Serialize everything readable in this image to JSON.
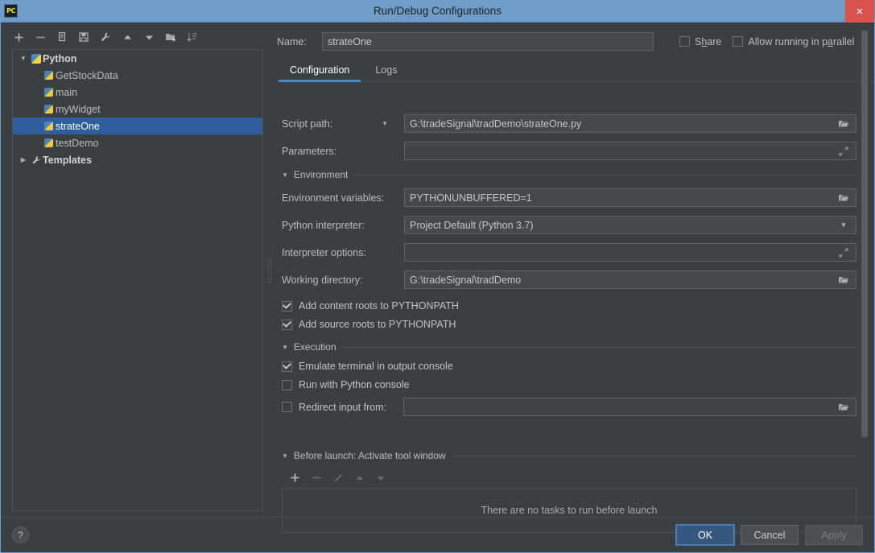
{
  "window": {
    "title": "Run/Debug Configurations",
    "app_icon": "pycharm-logo-icon",
    "close_label": "×"
  },
  "left_panel": {
    "toolbar": [
      {
        "name": "add-configuration-button",
        "icon": "plus-icon"
      },
      {
        "name": "remove-configuration-button",
        "icon": "minus-icon"
      },
      {
        "name": "copy-configuration-button",
        "icon": "copy-icon"
      },
      {
        "name": "save-configuration-button",
        "icon": "save-icon"
      },
      {
        "name": "edit-templates-button",
        "icon": "wrench-icon"
      },
      {
        "name": "move-up-button",
        "icon": "arrow-up-icon"
      },
      {
        "name": "move-down-button",
        "icon": "arrow-down-icon"
      },
      {
        "name": "move-into-folder-button",
        "icon": "new-folder-icon"
      },
      {
        "name": "sort-configurations-button",
        "icon": "sort-icon"
      }
    ],
    "tree": [
      {
        "label": "Python",
        "type": "group",
        "icon": "python-icon",
        "expanded": true,
        "selected": false
      },
      {
        "label": "GetStockData",
        "type": "leaf",
        "icon": "python-file-icon",
        "selected": false
      },
      {
        "label": "main",
        "type": "leaf",
        "icon": "python-file-icon",
        "selected": false
      },
      {
        "label": "myWidget",
        "type": "leaf",
        "icon": "python-file-icon",
        "selected": false
      },
      {
        "label": "strateOne",
        "type": "leaf",
        "icon": "python-file-icon",
        "selected": true
      },
      {
        "label": "testDemo",
        "type": "leaf",
        "icon": "python-file-icon",
        "selected": false
      },
      {
        "label": "Templates",
        "type": "group",
        "icon": "wrench-icon",
        "expanded": false,
        "selected": false
      }
    ]
  },
  "header": {
    "name_label": "Name:",
    "name_value": "strateOne",
    "share": {
      "label_pre": "S",
      "label_mnemonic": "h",
      "label_post": "are",
      "checked": false
    },
    "parallel": {
      "label_pre": "Allow running in p",
      "label_mnemonic": "a",
      "label_post": "rallel",
      "checked": false
    }
  },
  "tabs": [
    {
      "label": "Configuration",
      "active": true
    },
    {
      "label": "Logs",
      "active": false
    }
  ],
  "form": {
    "script_path": {
      "label": "Script path:",
      "value": "G:\\tradeSignal\\tradDemo\\strateOne.py",
      "browse_icon": "folder-icon",
      "has_dropdown": true
    },
    "parameters": {
      "label": "Parameters:",
      "value": "",
      "expand_icon": "expand-icon"
    },
    "environment_section": {
      "title": "Environment",
      "expanded": true
    },
    "environment_variables": {
      "label": "Environment variables:",
      "value": "PYTHONUNBUFFERED=1",
      "browse_icon": "folder-icon"
    },
    "python_interpreter": {
      "label": "Python interpreter:",
      "value": "Project Default (Python 3.7)",
      "dropdown_icon": "chevron-down-icon"
    },
    "interpreter_options": {
      "label": "Interpreter options:",
      "value": "",
      "expand_icon": "expand-icon"
    },
    "working_directory": {
      "label": "Working directory:",
      "value": "G:\\tradeSignal\\tradDemo",
      "browse_icon": "folder-icon"
    },
    "add_content_roots": {
      "label": "Add content roots to PYTHONPATH",
      "checked": true
    },
    "add_source_roots": {
      "label": "Add source roots to PYTHONPATH",
      "checked": true
    },
    "execution_section": {
      "title": "Execution",
      "expanded": true
    },
    "emulate_terminal": {
      "label": "Emulate terminal in output console",
      "checked": true
    },
    "run_with_console": {
      "label": "Run with Python console",
      "checked": false
    },
    "redirect_input": {
      "label": "Redirect input from:",
      "checked": false,
      "value": "",
      "browse_icon": "folder-icon"
    }
  },
  "before_launch": {
    "section_title": "Before launch: Activate tool window",
    "expanded": true,
    "toolbar": [
      {
        "name": "add-task-button",
        "icon": "plus-icon",
        "enabled": true
      },
      {
        "name": "remove-task-button",
        "icon": "minus-icon",
        "enabled": false
      },
      {
        "name": "edit-task-button",
        "icon": "pencil-icon",
        "enabled": false
      },
      {
        "name": "task-move-up-button",
        "icon": "arrow-up-icon",
        "enabled": false
      },
      {
        "name": "task-move-down-button",
        "icon": "arrow-down-icon",
        "enabled": false
      }
    ],
    "empty_text": "There are no tasks to run before launch"
  },
  "footer": {
    "help_label": "?",
    "ok_label": "OK",
    "cancel_label": "Cancel",
    "apply_label": "Apply"
  },
  "colors": {
    "titlebar": "#6f9dc8",
    "background": "#3c3f41",
    "selection": "#2f5d9e",
    "accent": "#4a88c7",
    "default_button": "#365880",
    "close_button": "#d9534f"
  }
}
